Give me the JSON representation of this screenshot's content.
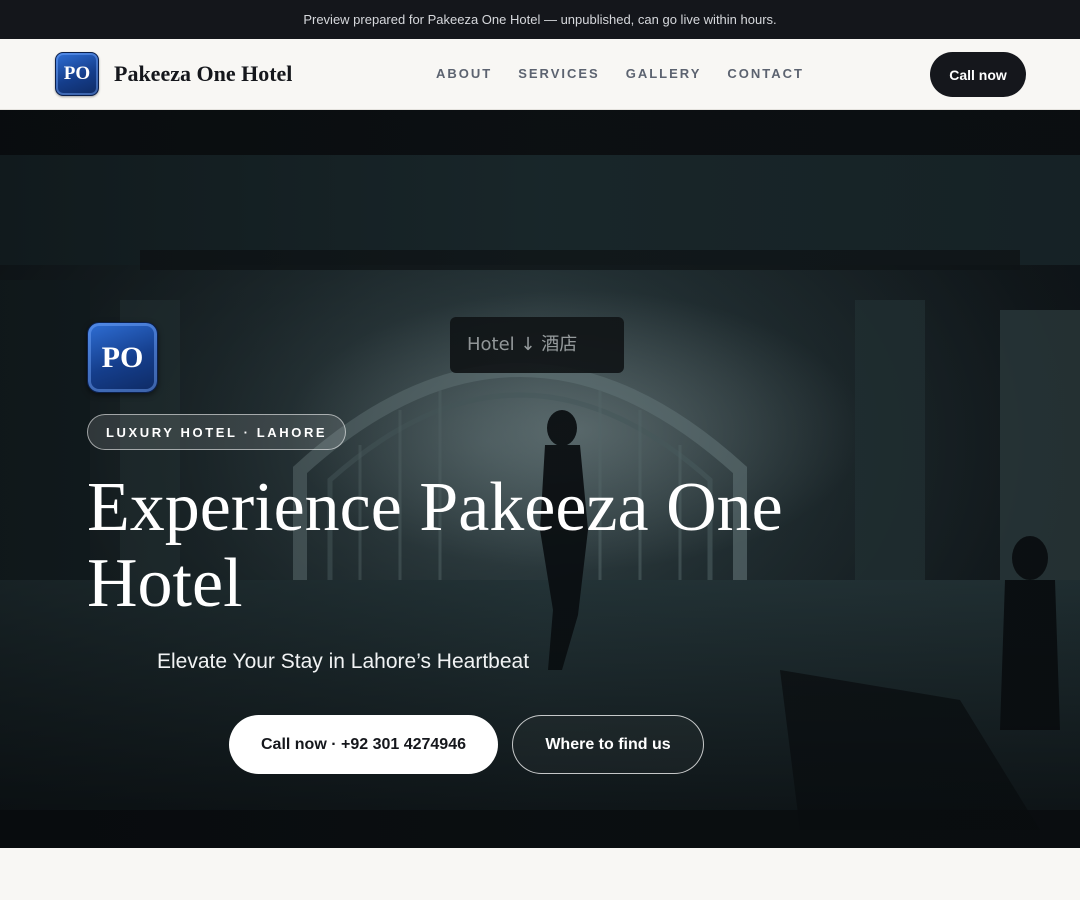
{
  "preview_banner": "Preview prepared for Pakeeza One Hotel — unpublished, can go live within hours.",
  "header": {
    "logo_initials": "PO",
    "brand_name": "Pakeeza One Hotel",
    "nav": [
      "ABOUT",
      "SERVICES",
      "GALLERY",
      "CONTACT"
    ],
    "cta_label": "Call now"
  },
  "hero": {
    "logo_initials": "PO",
    "eyebrow": "LUXURY HOTEL · LAHORE",
    "title": "Experience Pakeeza One Hotel",
    "subtitle": "Elevate Your Stay in Lahore’s Heartbeat",
    "primary_button": "Call now · +92 301 4274946",
    "secondary_button": "Where to find us",
    "photo_sign_text": "Hotel ↓ 酒店"
  },
  "colors": {
    "dark": "#15171c",
    "badge_blue": "#153e8c",
    "banner_bg": "#14161b",
    "page_bg": "#f8f7f4"
  }
}
